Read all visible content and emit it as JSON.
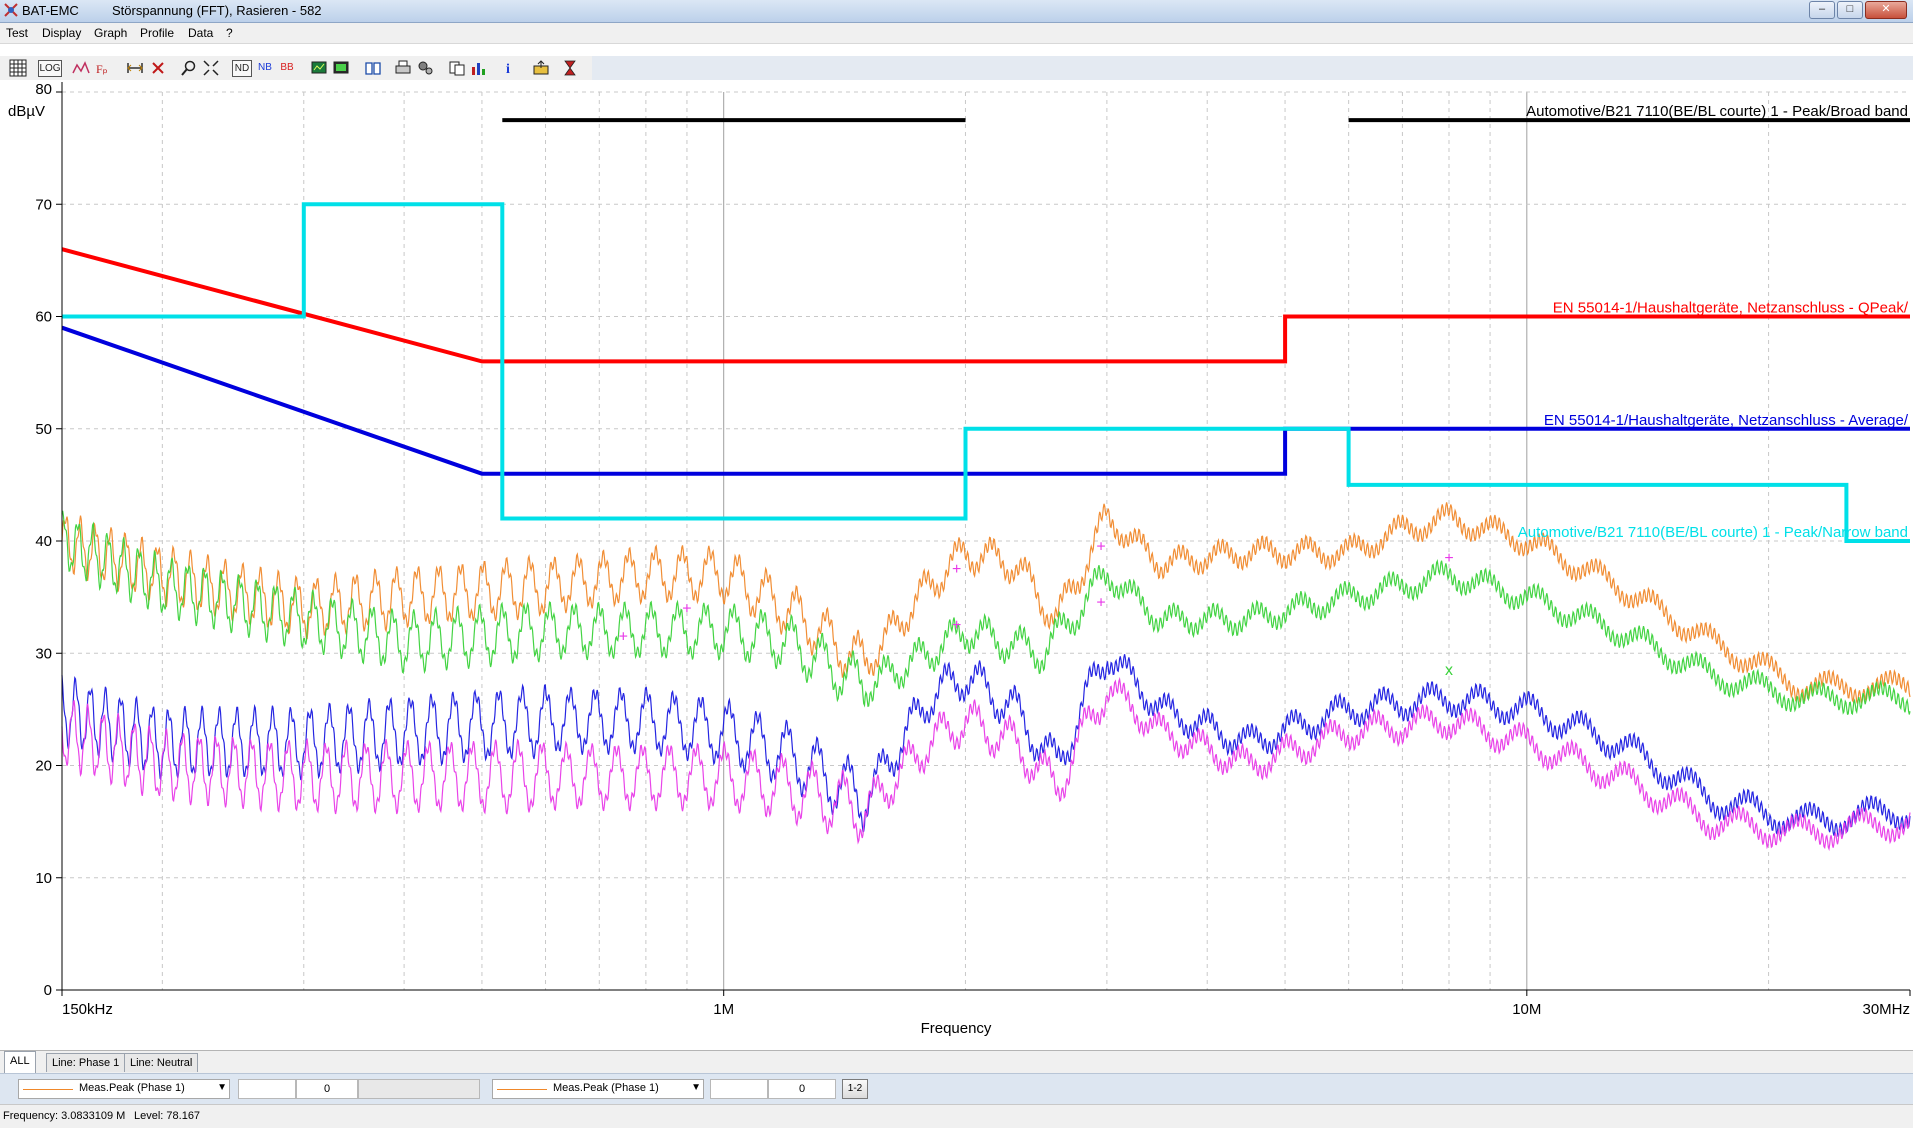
{
  "window": {
    "app_name": "BAT-EMC",
    "doc_title": "Störspannung (FFT), Rasieren - 582",
    "buttons": [
      "–",
      "□",
      "✕"
    ]
  },
  "menu": [
    {
      "label": "Test"
    },
    {
      "label": "Display"
    },
    {
      "label": "Graph"
    },
    {
      "label": "Profile"
    },
    {
      "label": "Data"
    },
    {
      "label": "?"
    }
  ],
  "toolbar": {
    "icons": [
      "grid-icon",
      "log-scale-icon",
      "peak-marker-icon",
      "function-icon",
      "range-icon",
      "delete-icon",
      "zoom-icon",
      "fit-icon",
      "nd-toggle",
      "nb-toggle",
      "bb-toggle",
      "display-icon",
      "monitor-icon",
      "book-icon",
      "print-icon",
      "settings-icon",
      "copy-icon",
      "bar-chart-icon",
      "info-icon",
      "export-icon",
      "hourglass-icon"
    ],
    "nd_label": "ND",
    "nb_label": "NB",
    "bb_label": "BB",
    "log_label": "LOG"
  },
  "chart_data": {
    "type": "line",
    "ylabel": "dBµV",
    "xlabel": "Frequency",
    "x_scale": "log",
    "xlim_mhz": [
      0.15,
      30
    ],
    "ylim": [
      0,
      80
    ],
    "y_ticks": [
      0,
      10,
      20,
      30,
      40,
      50,
      60,
      70,
      80
    ],
    "x_tick_labels": [
      {
        "mhz": 0.15,
        "label": "150kHz"
      },
      {
        "mhz": 1,
        "label": "1M"
      },
      {
        "mhz": 10,
        "label": "10M"
      },
      {
        "mhz": 30,
        "label": "30MHz"
      }
    ],
    "grid": true,
    "limit_lines": [
      {
        "name": "Automotive/B21 7110(BE/BL courte) 1 - Peak/Broad band",
        "color": "#000000",
        "segments": [
          [
            [
              0.53,
              77.5
            ],
            [
              2.0,
              77.5
            ]
          ],
          [
            [
              6.0,
              77.5
            ],
            [
              30,
              77.5
            ]
          ]
        ]
      },
      {
        "name": "EN 55014-1/Haushaltgeräte, Netzanschluss  - QPeak/",
        "color": "#ff0000",
        "points": [
          [
            0.15,
            66
          ],
          [
            0.5,
            56
          ],
          [
            5.0,
            56
          ],
          [
            5.0,
            60
          ],
          [
            30,
            60
          ]
        ]
      },
      {
        "name": "EN 55014-1/Haushaltgeräte, Netzanschluss  - Average/",
        "color": "#0000dd",
        "points": [
          [
            0.15,
            59
          ],
          [
            0.5,
            46
          ],
          [
            5.0,
            46
          ],
          [
            5.0,
            50
          ],
          [
            30,
            50
          ]
        ]
      },
      {
        "name": "Automotive/B21 7110(BE/BL courte) 1 - Peak/Narrow band",
        "color": "#00e0e8",
        "points": [
          [
            0.15,
            60
          ],
          [
            0.3,
            60
          ],
          [
            0.3,
            70
          ],
          [
            0.53,
            70
          ],
          [
            0.53,
            42
          ],
          [
            2.0,
            42
          ],
          [
            2.0,
            50
          ],
          [
            6.0,
            50
          ],
          [
            6.0,
            45
          ],
          [
            25,
            45
          ],
          [
            25,
            40
          ],
          [
            30,
            40
          ]
        ]
      }
    ],
    "series": [
      {
        "color": "#f0882a",
        "points": [
          [
            0.15,
            40
          ],
          [
            0.2,
            37
          ],
          [
            0.3,
            34
          ],
          [
            0.4,
            35
          ],
          [
            0.6,
            36
          ],
          [
            0.8,
            37
          ],
          [
            1.0,
            37
          ],
          [
            1.2,
            34
          ],
          [
            1.5,
            29
          ],
          [
            1.8,
            36
          ],
          [
            2.0,
            39
          ],
          [
            2.3,
            38
          ],
          [
            2.6,
            33
          ],
          [
            3.0,
            42
          ],
          [
            3.5,
            38
          ],
          [
            4.5,
            39
          ],
          [
            6.0,
            39
          ],
          [
            7.0,
            41
          ],
          [
            8.0,
            42
          ],
          [
            10,
            40
          ],
          [
            13,
            36
          ],
          [
            17,
            31
          ],
          [
            22,
            27
          ],
          [
            30,
            27
          ]
        ]
      },
      {
        "color": "#3ad23a",
        "points": [
          [
            0.15,
            40
          ],
          [
            0.2,
            36
          ],
          [
            0.3,
            33
          ],
          [
            0.4,
            31
          ],
          [
            0.6,
            32
          ],
          [
            0.8,
            32
          ],
          [
            1.0,
            32
          ],
          [
            1.2,
            31
          ],
          [
            1.5,
            27
          ],
          [
            1.8,
            30
          ],
          [
            2.0,
            32
          ],
          [
            2.5,
            30
          ],
          [
            3.0,
            37
          ],
          [
            3.5,
            33
          ],
          [
            4.5,
            33
          ],
          [
            6.0,
            35
          ],
          [
            7.0,
            36
          ],
          [
            8.0,
            37
          ],
          [
            10,
            35
          ],
          [
            13,
            32
          ],
          [
            17,
            28
          ],
          [
            22,
            26
          ],
          [
            30,
            26
          ]
        ]
      },
      {
        "color": "#1a1ae0",
        "points": [
          [
            0.15,
            25
          ],
          [
            0.2,
            22
          ],
          [
            0.3,
            22
          ],
          [
            0.4,
            23
          ],
          [
            0.6,
            24
          ],
          [
            0.8,
            24
          ],
          [
            1.0,
            23
          ],
          [
            1.2,
            21
          ],
          [
            1.5,
            17
          ],
          [
            1.8,
            26
          ],
          [
            2.0,
            28
          ],
          [
            2.3,
            25
          ],
          [
            2.6,
            20
          ],
          [
            3.0,
            30
          ],
          [
            3.5,
            25
          ],
          [
            4.5,
            22
          ],
          [
            6.0,
            25
          ],
          [
            8.0,
            26
          ],
          [
            10,
            25
          ],
          [
            13,
            22
          ],
          [
            17,
            17
          ],
          [
            22,
            15
          ],
          [
            30,
            16
          ]
        ]
      },
      {
        "color": "#e83ae8",
        "points": [
          [
            0.15,
            23
          ],
          [
            0.2,
            20
          ],
          [
            0.3,
            19
          ],
          [
            0.4,
            19
          ],
          [
            0.6,
            19
          ],
          [
            0.8,
            19
          ],
          [
            1.0,
            19
          ],
          [
            1.2,
            18
          ],
          [
            1.5,
            16
          ],
          [
            1.8,
            22
          ],
          [
            2.0,
            24
          ],
          [
            2.3,
            22
          ],
          [
            2.6,
            18
          ],
          [
            3.0,
            27
          ],
          [
            3.5,
            23
          ],
          [
            4.5,
            20
          ],
          [
            6.0,
            23
          ],
          [
            8.0,
            24
          ],
          [
            10,
            22
          ],
          [
            13,
            19
          ],
          [
            17,
            15
          ],
          [
            22,
            14
          ],
          [
            30,
            15
          ]
        ]
      }
    ],
    "markers": [
      {
        "mhz": 0.75,
        "db": 31.5,
        "color": "#e83ae8",
        "symbol": "+"
      },
      {
        "mhz": 0.9,
        "db": 34,
        "color": "#e83ae8",
        "symbol": "+"
      },
      {
        "mhz": 1.95,
        "db": 37.5,
        "color": "#e83ae8",
        "symbol": "+"
      },
      {
        "mhz": 1.95,
        "db": 32.5,
        "color": "#e83ae8",
        "symbol": "+"
      },
      {
        "mhz": 2.95,
        "db": 39.5,
        "color": "#e83ae8",
        "symbol": "+"
      },
      {
        "mhz": 2.95,
        "db": 34.5,
        "color": "#e83ae8",
        "symbol": "+"
      },
      {
        "mhz": 8.0,
        "db": 38.5,
        "color": "#e83ae8",
        "symbol": "+"
      },
      {
        "mhz": 8.0,
        "db": 28.5,
        "color": "#3ad23a",
        "symbol": "x"
      }
    ]
  },
  "tabs": [
    {
      "label": "ALL",
      "active": true
    },
    {
      "label": "Line: Phase 1",
      "active": false
    },
    {
      "label": "Line: Neutral",
      "active": false
    }
  ],
  "bottom": {
    "left_select": "Meas.Peak (Phase 1)",
    "left_value": "0",
    "right_select": "Meas.Peak (Phase 1)",
    "right_value": "0",
    "diff_button": "1-2"
  },
  "status": {
    "frequency": "Frequency: 3.0833109 M",
    "level": "Level: 78.167"
  }
}
